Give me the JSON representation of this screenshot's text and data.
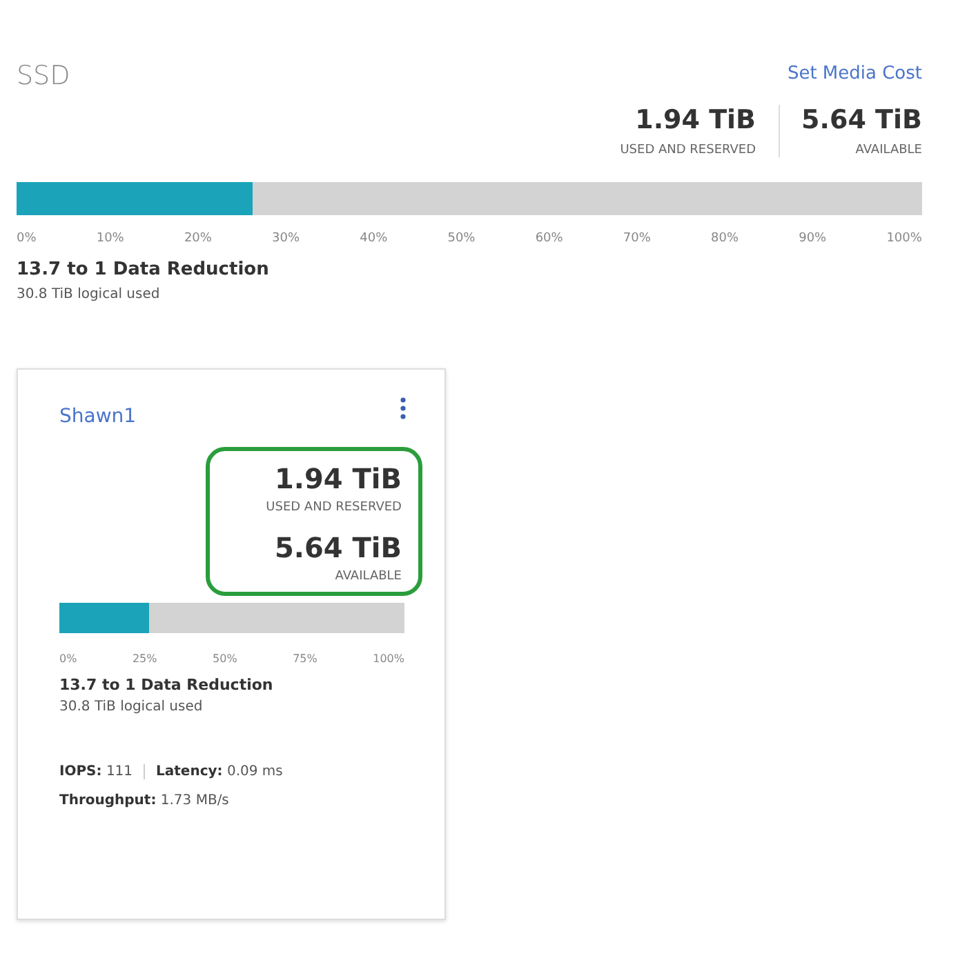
{
  "title": "SSD",
  "link": "Set Media Cost",
  "stats": [
    {
      "value": "1.94 TiB",
      "label": "USED AND RESERVED"
    },
    {
      "value": "5.64 TiB",
      "label": "AVAILABLE"
    }
  ],
  "bar": {
    "level": 0.26,
    "ticks": [
      "0%",
      "10%",
      "20%",
      "30%",
      "40%",
      "50%",
      "60%",
      "70%",
      "80%",
      "90%",
      "100%"
    ]
  },
  "reduction": "13.7 to 1 Data Reduction",
  "logical": "30.8 TiB logical used",
  "card": {
    "name": "Shawn1",
    "highlighted": true,
    "stats": [
      {
        "value": "1.94 TiB",
        "label": "USED AND RESERVED"
      },
      {
        "value": "5.64 TiB",
        "label": "AVAILABLE"
      }
    ],
    "bar": {
      "level": 0.26,
      "ticks": [
        "0%",
        "25%",
        "50%",
        "75%",
        "100%"
      ]
    },
    "reduction": "13.7 to 1 Data Reduction",
    "logical": "30.8 TiB logical used",
    "metrics": [
      [
        "**IOPS:** 111",
        "**Latency:** 0.09 ms"
      ],
      [
        "**Throughput:** 1.73 MB/s"
      ]
    ]
  }
}
